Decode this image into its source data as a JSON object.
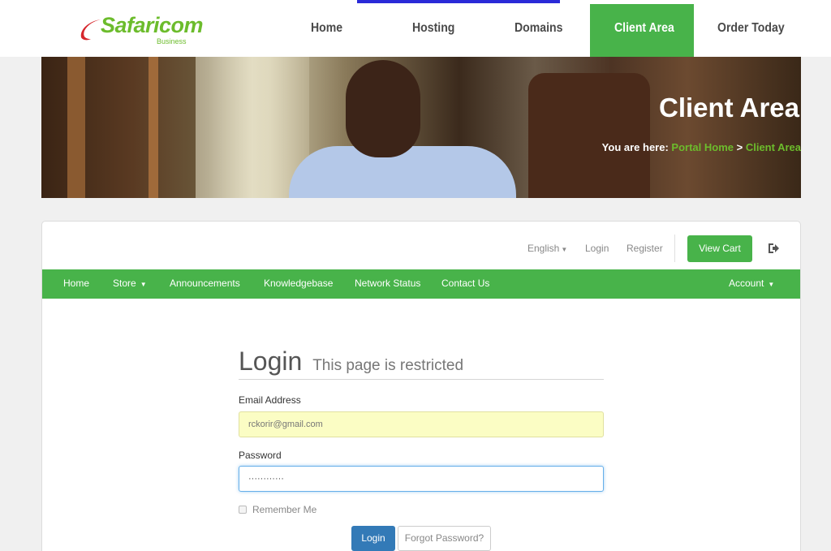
{
  "brand": {
    "name": "Safaricom",
    "subtitle": "Business"
  },
  "topnav": {
    "items": [
      {
        "label": "Home"
      },
      {
        "label": "Hosting"
      },
      {
        "label": "Domains"
      },
      {
        "label": "Client Area",
        "active": true
      },
      {
        "label": "Order Today"
      }
    ]
  },
  "hero": {
    "title": "Client Area",
    "breadcrumb": {
      "prefix": "You are here:",
      "items": [
        "Portal Home",
        "Client Area"
      ],
      "separator": ">"
    }
  },
  "utility": {
    "language": "English",
    "login": "Login",
    "register": "Register",
    "view_cart": "View Cart"
  },
  "nav": {
    "items": [
      {
        "label": "Home"
      },
      {
        "label": "Store",
        "dropdown": true
      },
      {
        "label": "Announcements"
      },
      {
        "label": "Knowledgebase"
      },
      {
        "label": "Network Status"
      },
      {
        "label": "Contact Us"
      }
    ],
    "account": "Account"
  },
  "login_form": {
    "title": "Login",
    "subtitle": "This page is restricted",
    "email_label": "Email Address",
    "email_value": "rckorir@gmail.com",
    "password_label": "Password",
    "password_value": "············",
    "remember_label": "Remember Me",
    "login_button": "Login",
    "forgot_button": "Forgot Password?"
  },
  "colors": {
    "brand_green": "#48b34a",
    "primary_blue": "#337ab7",
    "autofill_yellow": "#fbfdc4"
  }
}
